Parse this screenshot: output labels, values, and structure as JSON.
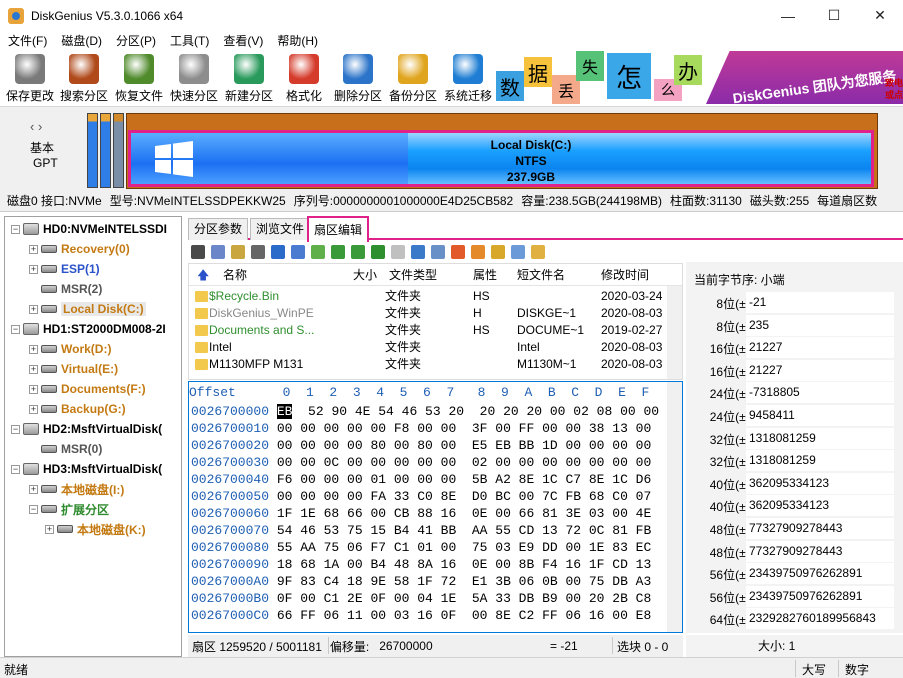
{
  "window": {
    "title": "DiskGenius V5.3.0.1066 x64",
    "min": "—",
    "max": "☐",
    "close": "✕"
  },
  "menu": [
    "文件(F)",
    "磁盘(D)",
    "分区(P)",
    "工具(T)",
    "查看(V)",
    "帮助(H)"
  ],
  "toolbar": [
    {
      "label": "保存更改",
      "icon": "save-changes-icon",
      "color": "#7a7a7a"
    },
    {
      "label": "搜索分区",
      "icon": "search-partition-icon",
      "color": "#b04a1a"
    },
    {
      "label": "恢复文件",
      "icon": "recover-files-icon",
      "color": "#4f8a2b"
    },
    {
      "label": "快速分区",
      "icon": "quick-partition-icon",
      "color": "#8d8d8d"
    },
    {
      "label": "新建分区",
      "icon": "new-partition-icon",
      "color": "#2a9a5c"
    },
    {
      "label": "格式化",
      "icon": "format-icon",
      "color": "#d43b2b"
    },
    {
      "label": "删除分区",
      "icon": "delete-partition-icon",
      "color": "#2c74c9"
    },
    {
      "label": "备份分区",
      "icon": "backup-partition-icon",
      "color": "#e0a51e"
    },
    {
      "label": "系统迁移",
      "icon": "system-migration-icon",
      "color": "#1f7ed3"
    }
  ],
  "banner": {
    "chars": [
      "数",
      "据",
      "丢",
      "失",
      "怎",
      "么",
      "办"
    ],
    "slogan": "DiskGenius 团队为您服务",
    "right1": "致电",
    "right2": "或点"
  },
  "disk_panel": {
    "nav": "‹ ›",
    "type1": "基本",
    "type2": "GPT",
    "partition": {
      "name": "Local Disk(C:)",
      "fs": "NTFS",
      "size": "237.9GB"
    }
  },
  "disk_info": [
    "磁盘0 接口:NVMe",
    "型号:NVMeINTELSSDPEKKW25",
    "序列号:0000000001000000E4D25CB582",
    "容量:238.5GB(244198MB)",
    "柱面数:31130",
    "磁头数:255",
    "每道扇区数"
  ],
  "tree": [
    {
      "label": "HD0:NVMeINTELSSDI",
      "kind": "disk",
      "color": "#000000"
    },
    {
      "label": "Recovery(0)",
      "kind": "part",
      "color": "#c47a12"
    },
    {
      "label": "ESP(1)",
      "kind": "part",
      "color": "#2a52c9"
    },
    {
      "label": "MSR(2)",
      "kind": "part",
      "color": "#555555"
    },
    {
      "label": "Local Disk(C:)",
      "kind": "part",
      "color": "#c47a12"
    },
    {
      "label": "HD1:ST2000DM008-2I",
      "kind": "disk",
      "color": "#000000"
    },
    {
      "label": "Work(D:)",
      "kind": "part",
      "color": "#c47a12"
    },
    {
      "label": "Virtual(E:)",
      "kind": "part",
      "color": "#c47a12"
    },
    {
      "label": "Documents(F:)",
      "kind": "part",
      "color": "#c47a12"
    },
    {
      "label": "Backup(G:)",
      "kind": "part",
      "color": "#c47a12"
    },
    {
      "label": "HD2:MsftVirtualDisk(",
      "kind": "disk",
      "color": "#000000"
    },
    {
      "label": "MSR(0)",
      "kind": "part",
      "color": "#555555"
    },
    {
      "label": "HD3:MsftVirtualDisk(",
      "kind": "disk",
      "color": "#000000"
    },
    {
      "label": "本地磁盘(I:)",
      "kind": "part",
      "color": "#c47a12"
    },
    {
      "label": "扩展分区",
      "kind": "part",
      "color": "#2e8b2e"
    },
    {
      "label": "本地磁盘(K:)",
      "kind": "part",
      "color": "#c47a12"
    }
  ],
  "tabs": [
    "分区参数",
    "浏览文件",
    "扇区编辑"
  ],
  "filelist": {
    "headers": [
      "名称",
      "大小",
      "文件类型",
      "属性",
      "短文件名",
      "修改时间"
    ],
    "rows": [
      {
        "name": "$Recycle.Bin",
        "size": "",
        "type": "文件夹",
        "attr": "HS",
        "short": "",
        "mtime": "2020-03-24",
        "color": "#2f8f2f"
      },
      {
        "name": "DiskGenius_WinPE",
        "size": "",
        "type": "文件夹",
        "attr": "H",
        "short": "DISKGE~1",
        "mtime": "2020-08-03",
        "color": "#888888"
      },
      {
        "name": "Documents and S...",
        "size": "",
        "type": "文件夹",
        "attr": "HS",
        "short": "DOCUME~1",
        "mtime": "2019-02-27",
        "color": "#2f8f2f"
      },
      {
        "name": "Intel",
        "size": "",
        "type": "文件夹",
        "attr": "",
        "short": "Intel",
        "mtime": "2020-08-03",
        "color": "#000000"
      },
      {
        "name": "M1130MFP M131",
        "size": "",
        "type": "文件夹",
        "attr": "",
        "short": "M1130M~1",
        "mtime": "2020-08-03",
        "color": "#000000"
      }
    ]
  },
  "hex": {
    "header": "Offset      0  1  2  3  4  5  6  7   8  9  A  B  C  D  E  F",
    "rows": [
      {
        "off": "0026700000",
        "bytes": "  52 90 4E 54 46 53 20  20 20 20 00 02 08 00 00",
        "first": "EB"
      },
      {
        "off": "0026700010",
        "bytes": "00 00 00 00 00 F8 00 00  3F 00 FF 00 00 38 13 00"
      },
      {
        "off": "0026700020",
        "bytes": "00 00 00 00 80 00 80 00  E5 EB BB 1D 00 00 00 00"
      },
      {
        "off": "0026700030",
        "bytes": "00 00 0C 00 00 00 00 00  02 00 00 00 00 00 00 00"
      },
      {
        "off": "0026700040",
        "bytes": "F6 00 00 00 01 00 00 00  5B A2 8E 1C C7 8E 1C D6"
      },
      {
        "off": "0026700050",
        "bytes": "00 00 00 00 FA 33 C0 8E  D0 BC 00 7C FB 68 C0 07"
      },
      {
        "off": "0026700060",
        "bytes": "1F 1E 68 66 00 CB 88 16  0E 00 66 81 3E 03 00 4E"
      },
      {
        "off": "0026700070",
        "bytes": "54 46 53 75 15 B4 41 BB  AA 55 CD 13 72 0C 81 FB"
      },
      {
        "off": "0026700080",
        "bytes": "55 AA 75 06 F7 C1 01 00  75 03 E9 DD 00 1E 83 EC"
      },
      {
        "off": "0026700090",
        "bytes": "18 68 1A 00 B4 48 8A 16  0E 00 8B F4 16 1F CD 13"
      },
      {
        "off": "00267000A0",
        "bytes": "9F 83 C4 18 9E 58 1F 72  E1 3B 06 0B 00 75 DB A3"
      },
      {
        "off": "00267000B0",
        "bytes": "0F 00 C1 2E 0F 00 04 1E  5A 33 DB B9 00 20 2B C8"
      },
      {
        "off": "00267000C0",
        "bytes": "66 FF 06 11 00 03 16 0F  00 8E C2 FF 06 16 00 E8"
      }
    ]
  },
  "hex_status": {
    "sector": "扇区 1259520 / 5001181",
    "offset_label": "偏移量:",
    "offset": "26700000",
    "value": "= -21",
    "selection": "选块 0 - 0"
  },
  "right_panel": {
    "title": "当前字节序:  小端",
    "rows": [
      {
        "label": "8位(±):",
        "value": "-21"
      },
      {
        "label": "8位(±):",
        "value": "235"
      },
      {
        "label": "16位(±):",
        "value": "21227"
      },
      {
        "label": "16位(±):",
        "value": "21227"
      },
      {
        "label": "24位(±):",
        "value": "-7318805"
      },
      {
        "label": "24位(±):",
        "value": "9458411"
      },
      {
        "label": "32位(±):",
        "value": "1318081259"
      },
      {
        "label": "32位(±):",
        "value": "1318081259"
      },
      {
        "label": "40位(±):",
        "value": "362095334123"
      },
      {
        "label": "40位(±):",
        "value": "362095334123"
      },
      {
        "label": "48位(±):",
        "value": "77327909278443"
      },
      {
        "label": "48位(±):",
        "value": "77327909278443"
      },
      {
        "label": "56位(±):",
        "value": "23439750976262891"
      },
      {
        "label": "56位(±):",
        "value": "23439750976262891"
      },
      {
        "label": "64位(±):",
        "value": "2329282760189956843"
      }
    ],
    "size_label": "大小: 1"
  },
  "status": {
    "left": "就绪",
    "caps": "大写",
    "num": "数字"
  }
}
